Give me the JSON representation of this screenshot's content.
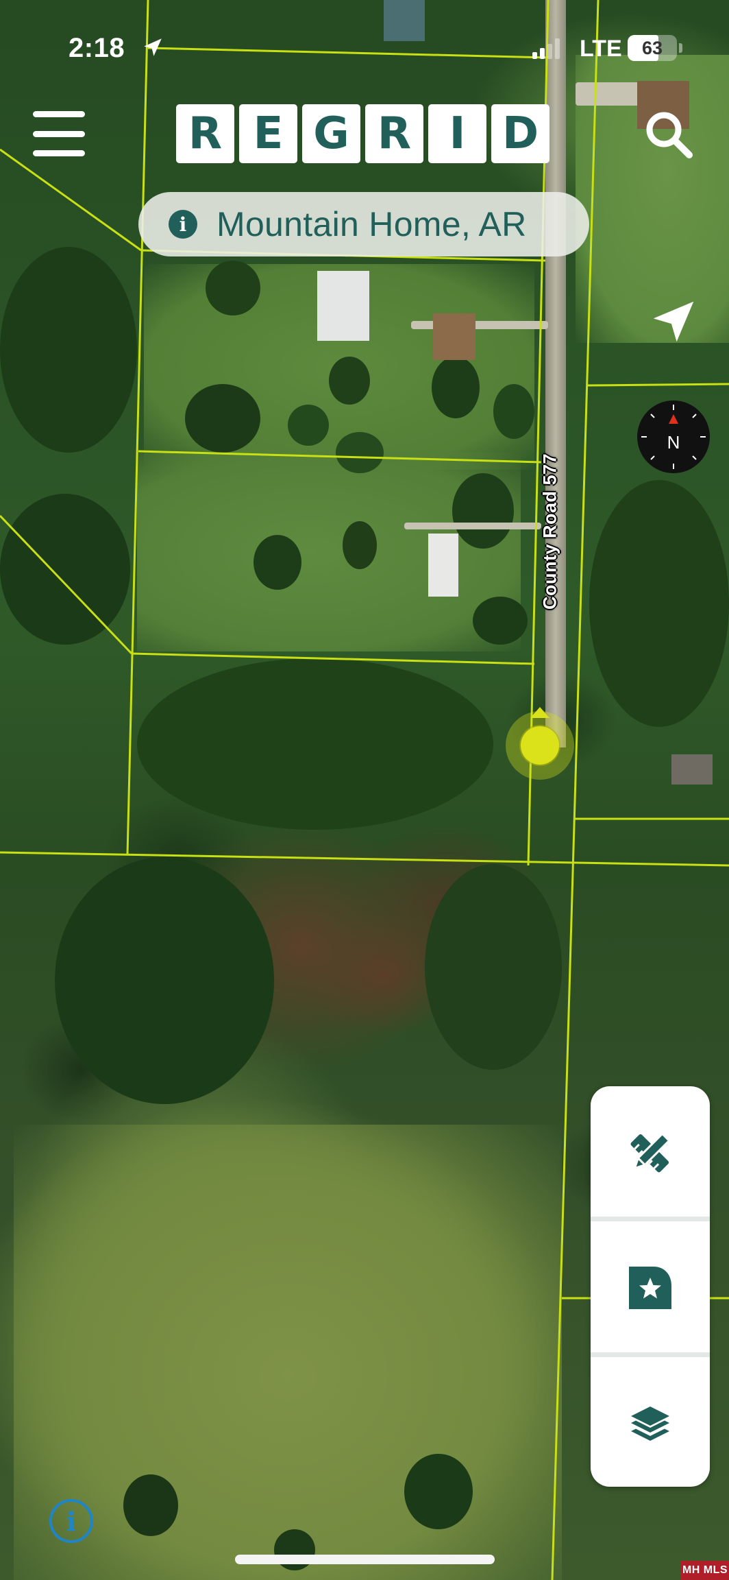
{
  "status_bar": {
    "time": "2:18",
    "network": "LTE",
    "battery_level": "63",
    "battery_fraction": 0.63,
    "signal_bars_active": 2,
    "signal_bars_total": 4
  },
  "header": {
    "logo_letters": [
      "R",
      "E",
      "G",
      "R",
      "I",
      "D"
    ],
    "menu_icon": "hamburger-icon",
    "search_icon": "search-icon"
  },
  "location_pill": {
    "icon": "info-icon",
    "text": "Mountain Home, AR"
  },
  "map": {
    "type": "satellite",
    "road_label": "County Road 577",
    "parcel_line_color": "#c8e014",
    "marker_color": "#dce21a",
    "compass_label": "N"
  },
  "tools": [
    {
      "name": "draw-tool",
      "icon": "pencil-ruler-icon"
    },
    {
      "name": "saved-places",
      "icon": "bookmark-star-icon"
    },
    {
      "name": "map-layers",
      "icon": "layers-icon"
    }
  ],
  "map_info_icon": "i",
  "watermark": "MH MLS",
  "colors": {
    "brand": "#21605a",
    "panel": "#ffffff",
    "info_blue": "#1e86c8"
  }
}
